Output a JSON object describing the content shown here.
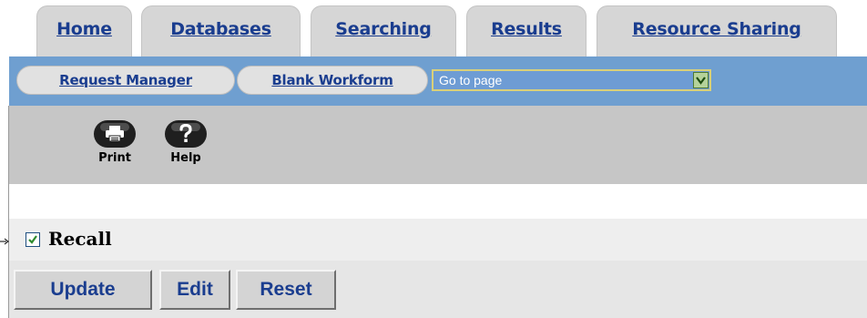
{
  "tabs": [
    {
      "label": "Home"
    },
    {
      "label": "Databases"
    },
    {
      "label": "Searching"
    },
    {
      "label": "Results"
    },
    {
      "label": "Resource Sharing"
    }
  ],
  "nav": {
    "request_manager": "Request Manager",
    "blank_workform": "Blank Workform",
    "goto_value": "Go to page"
  },
  "toolbar": {
    "print_label": "Print",
    "help_label": "Help",
    "print_icon": "printer-icon",
    "help_icon": "question-mark-icon"
  },
  "recall": {
    "label": "Recall",
    "checked": true
  },
  "actions": {
    "update": "Update",
    "edit": "Edit",
    "reset": "Reset"
  },
  "colors": {
    "nav_blue": "#6f9fd0",
    "link_blue": "#1a3d8f",
    "toolbar_gray": "#c6c6c6",
    "checkbox_green": "#2e8b2e"
  }
}
